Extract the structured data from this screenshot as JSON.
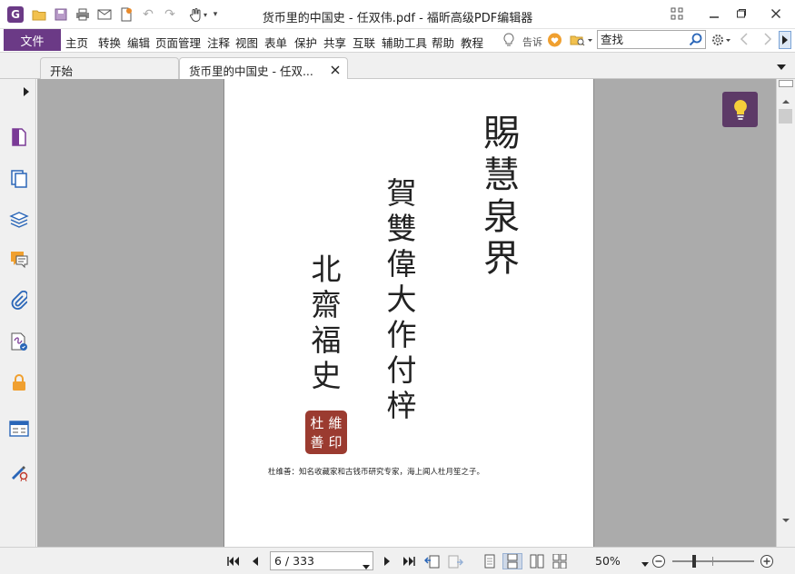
{
  "window": {
    "title": "货币里的中国史 - 任双伟.pdf - 福昕高级PDF编辑器",
    "logo_letter": "G"
  },
  "menubar": {
    "file_label": "文件",
    "items": [
      "主页",
      "转换",
      "编辑",
      "页面管理",
      "注释",
      "视图",
      "表单",
      "保护",
      "共享",
      "互联",
      "辅助工具",
      "帮助",
      "教程"
    ],
    "tell_me_label": "告诉",
    "search_placeholder": "查找"
  },
  "tabs": [
    {
      "label": "开始",
      "active": false
    },
    {
      "label": "货币里的中国史 - 任双...",
      "active": true
    }
  ],
  "left_toolbar": {
    "icons": [
      "page-thumbnail-icon",
      "pages-icon",
      "layers-icon",
      "comments-icon",
      "attachments-icon",
      "signature-icon",
      "security-lock-icon",
      "form-fields-icon",
      "certify-icon"
    ]
  },
  "document": {
    "calligraphy": {
      "column_1": "賜慧泉界",
      "column_2": "賀雙偉大作付梓",
      "column_3": "北齋福史"
    },
    "seal_chars": [
      "杜",
      "維",
      "善",
      "印"
    ],
    "caption": "杜维善：知名收藏家和古钱币研究专家，海上闻人杜月笙之子。"
  },
  "statusbar": {
    "page_display": "6 / 333",
    "current_page": 6,
    "total_pages": 333,
    "zoom": "50%",
    "zoom_fraction": 0.5
  },
  "colors": {
    "brand": "#6b3a86",
    "tips_button": "#5d3a67",
    "seal": "#9b3b30",
    "doc_background": "#ababab"
  }
}
